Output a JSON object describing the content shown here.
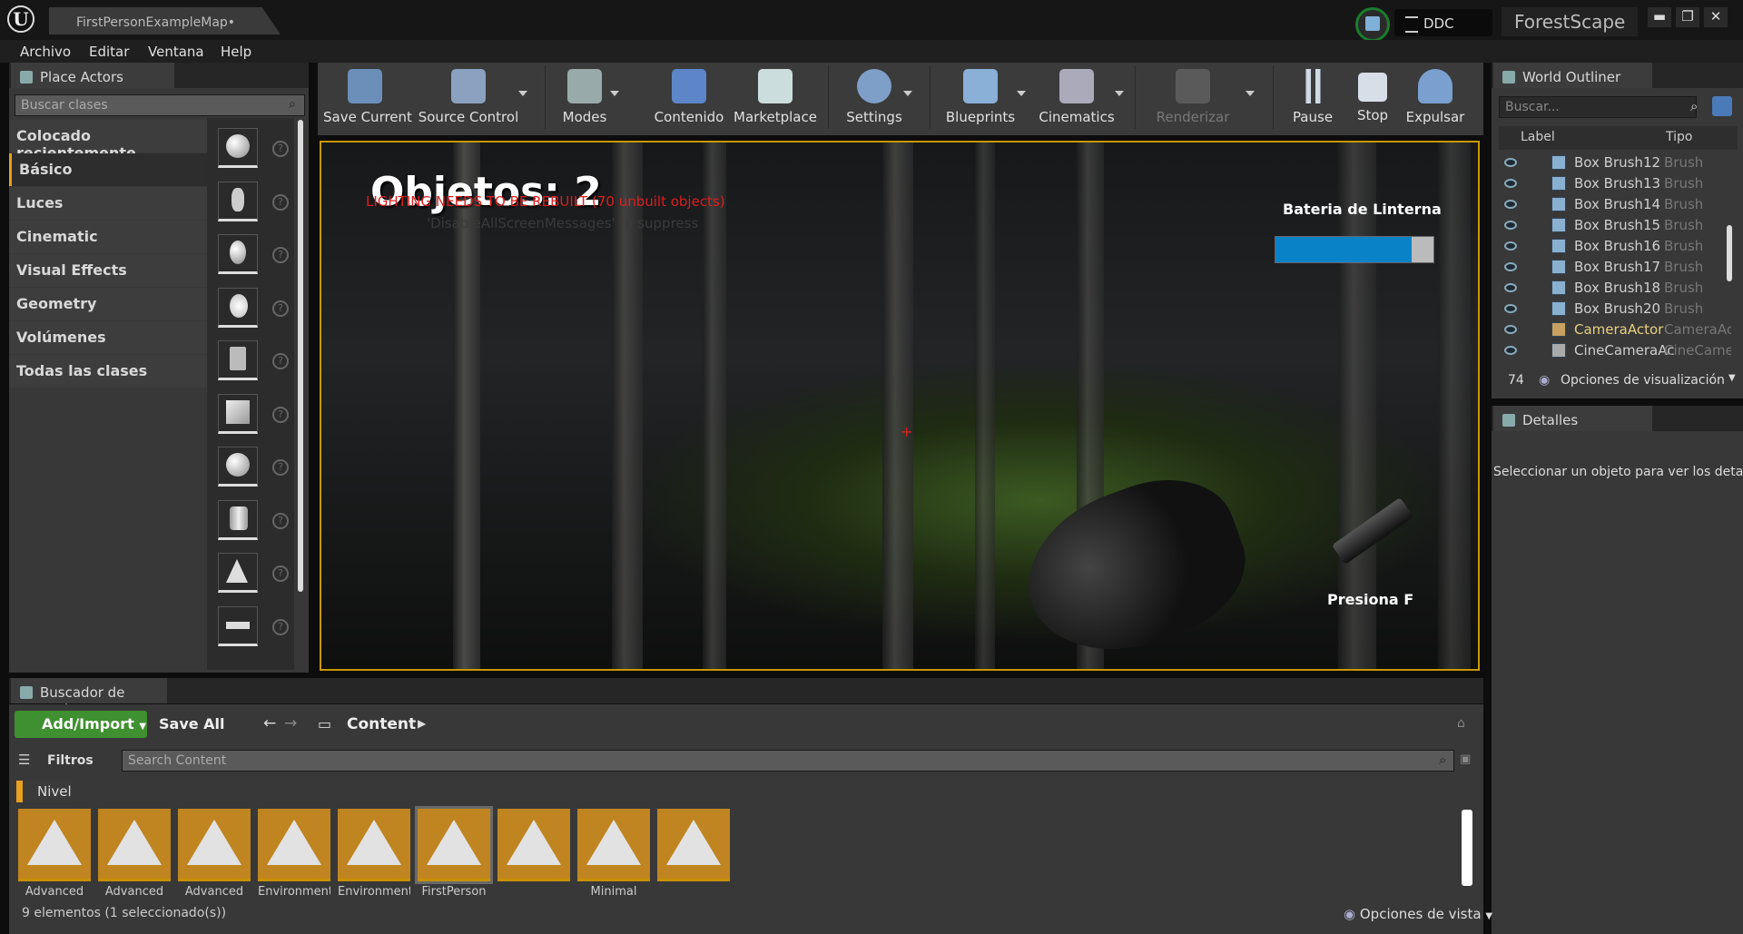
{
  "window": {
    "tab_title": "FirstPersonExampleMap•",
    "ddc_label": "DDC",
    "project_name": "ForestScape",
    "minimize": "▬",
    "restore": "❐",
    "close": "✕"
  },
  "menu": [
    "Archivo",
    "Editar",
    "Ventana",
    "Help"
  ],
  "place_actors": {
    "tab": "Place Actors",
    "search_placeholder": "Buscar clases",
    "categories": [
      "Colocado recientemente",
      "Básico",
      "Luces",
      "Cinematic",
      "Visual Effects",
      "Geometry",
      "Volúmenes",
      "Todas las clases"
    ],
    "selected_category": "Básico",
    "help_glyph": "?"
  },
  "toolbar": {
    "buttons": [
      "Save Current",
      "Source Control",
      "Modes",
      "Contenido",
      "Marketplace",
      "Settings",
      "Blueprints",
      "Cinematics",
      "Renderizar",
      "Pause",
      "Stop",
      "Expulsar"
    ]
  },
  "viewport": {
    "objects_text": "Objetos: 2",
    "lighting_warning": "LIGHTING NEEDS TO BE REBUILT (70 unbuilt objects)",
    "suppress_hint": "'DisableAllScreenMessages' to suppress",
    "battery_label": "Bateria de Linterna",
    "battery_level": 0.86,
    "crosshair": "+",
    "prompt": "Presiona F"
  },
  "world_outliner": {
    "tab": "World Outliner",
    "search_placeholder": "Buscar...",
    "col_label": "Label",
    "col_type": "Tipo",
    "rows": [
      {
        "label": "Box Brush12",
        "type": "Brush"
      },
      {
        "label": "Box Brush13",
        "type": "Brush"
      },
      {
        "label": "Box Brush14",
        "type": "Brush"
      },
      {
        "label": "Box Brush15",
        "type": "Brush"
      },
      {
        "label": "Box Brush16",
        "type": "Brush"
      },
      {
        "label": "Box Brush17",
        "type": "Brush"
      },
      {
        "label": "Box Brush18",
        "type": "Brush"
      },
      {
        "label": "Box Brush20",
        "type": "Brush"
      },
      {
        "label": "CameraActor",
        "type": "CameraAc"
      },
      {
        "label": "CineCameraAc",
        "type": "CineCame"
      }
    ],
    "count": "74",
    "view_options": "Opciones de visualización"
  },
  "details": {
    "tab": "Detalles",
    "empty_message": "Seleccionar un objeto para ver los detall"
  },
  "content_browser": {
    "tab": "Buscador de conte",
    "add_import": "Add/Import",
    "save_all": "Save All",
    "path": "Content",
    "filters": "Filtros",
    "search_placeholder": "Search Content",
    "tag": "Nivel",
    "assets": [
      "Advanced",
      "Advanced",
      "Advanced",
      "Environment",
      "Environment...",
      "FirstPerson",
      "",
      "Minimal",
      ""
    ],
    "status": "9 elementos (1 seleccionado(s))",
    "view_options": "Opciones de vista"
  }
}
